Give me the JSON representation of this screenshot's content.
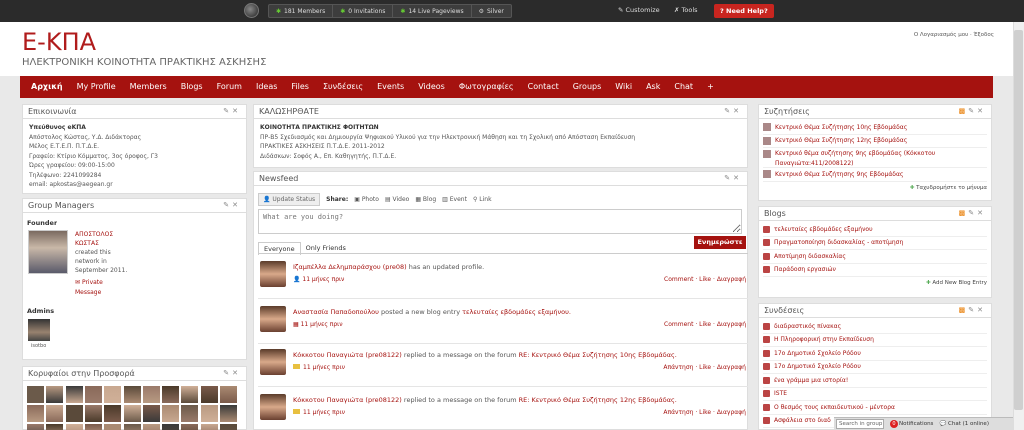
{
  "topbar": {
    "stats": [
      "181 Members",
      "0 Invitations",
      "14 Live Pageviews",
      "Silver"
    ],
    "customize": "Customize",
    "tools": "Tools",
    "help": "Need Help?"
  },
  "header": {
    "brand": "Ε-ΚΠΑ",
    "subtitle": "ΗΛΕΚΤΡΟΝΙΚΗ ΚΟΙΝΟΤΗΤΑ ΠΡΑΚΤΙΚΗΣ ΑΣΚΗΣΗΣ",
    "account": "Ο Λογαριασμός μου",
    "signout": "Έξοδος"
  },
  "nav": [
    "Αρχική",
    "My Profile",
    "Members",
    "Blogs",
    "Forum",
    "Ideas",
    "Files",
    "Συνδέσεις",
    "Events",
    "Videos",
    "Φωτογραφίες",
    "Contact",
    "Groups",
    "Wiki",
    "Ask",
    "Chat",
    "+"
  ],
  "contact": {
    "title": "Επικοινωνία",
    "lines": [
      "Υπεύθυνος eΚΠΑ",
      "Απόστολος Κώστας, Υ.Δ. Διδάκτορας",
      "Μέλος Ε.Τ.Ε.Π. Π.Τ.Δ.Ε.",
      "Γραφείο: Κτίριο Κόμματος, 3ος όροφος, Γ3",
      "Ώρες γραφείου: 09:00-15:00",
      "Τηλέφωνο: 2241099284",
      "email: apkostas@aegean.gr"
    ]
  },
  "managers": {
    "title": "Group Managers",
    "founder_label": "Founder",
    "founder_name1": "ΑΠΟΣΤΟΛΟΣ",
    "founder_name2": "ΚΩΣΤΑΣ",
    "founder_info": [
      "created this",
      "network in",
      "September 2011."
    ],
    "private_message": "Private Message",
    "admins_label": "Admins",
    "admin_name": "isotbo"
  },
  "top_contributors": {
    "title": "Κορυφαίοι στην Προσφορά"
  },
  "welcome": {
    "title": "ΚΑΛΩΣΗΡΘΑΤΕ",
    "lines": [
      "ΚΟΙΝΟΤΗΤΑ ΠΡΑΚΤΙΚΗΣ ΦΟΙΤΗΤΩΝ",
      "ΠΡ-Β5 Σχεδιασμός και Δημιουργία Ψηφιακού Υλικού για την Ηλεκτρονική Μάθηση και τη Σχολική από Απόσταση Εκπαίδευση",
      "ΠΡΑΚΤΙΚΕΣ ΑΣΚΗΣΕΙΣ Π.Τ.Δ.Ε. 2011-2012",
      "Διδάσκων: Σοφός Α., Επ. Καθηγητής, Π.Τ.Δ.Ε."
    ]
  },
  "newsfeed": {
    "title": "Newsfeed",
    "update_status": "Update Status",
    "share_label": "Share:",
    "share_items": [
      "Photo",
      "Video",
      "Blog",
      "Event",
      "Link"
    ],
    "placeholder": "What are you doing?",
    "post_button": "Ενημερώστε",
    "tab_everyone": "Everyone",
    "tab_friends": "Only Friends",
    "items": [
      {
        "name": "Ιζαμπέλλα Δελημπαράσχου (pre08)",
        "text": " has an updated profile.",
        "link": "",
        "time": "11 μήνες πριν",
        "actions": "Comment · Like · Διαγραφή"
      },
      {
        "name": "Αναστασία Παπαδοπούλου",
        "text": " posted a new blog entry ",
        "link": "τελευταίες εβδομάδες εξαμήνου.",
        "time": "11 μήνες πριν",
        "actions": "Comment · Like · Διαγραφή"
      },
      {
        "name": "Κόκκοτου Παναγιώτα (pre08122)",
        "text": " replied to a message on the forum ",
        "link": "RE: Κεντρικό Θέμα Συζήτησης 10ης Εβδομάδας.",
        "time": "11 μήνες πριν",
        "actions": "Απάντηση · Like · Διαγραφή"
      },
      {
        "name": "Κόκκοτου Παναγιώτα (pre08122)",
        "text": " replied to a message on the forum ",
        "link": "RE: Κεντρικό Θέμα Συζήτησης 12ης Εβδομάδας.",
        "time": "11 μήνες πριν",
        "actions": "Απάντηση · Like · Διαγραφή"
      }
    ]
  },
  "discussions": {
    "title": "Συζητήσεις",
    "items": [
      "Κεντρικό Θέμα Συζήτησης 10ης Εβδομάδας",
      "Κεντρικό Θέμα Συζήτησης 12ης Εβδομάδας",
      "Κεντρικό θέμα συζήτησης 9ης εβδομάδας (Κόκκοτου",
      "Παναγιώτα:411/2008122)",
      "Κεντρικό Θέμα Συζήτησης 9ης Εβδομάδας"
    ],
    "more": "Ταχυδρομήστε το μήνυμα"
  },
  "blogs": {
    "title": "Blogs",
    "items": [
      "τελευταίες εβδομάδες εξαμήνου",
      "Πραγματοποίηση διδασκαλίας - αποτίμηση",
      "Αποτίμηση διδασκαλίας",
      "Παράδοση εργασιών"
    ],
    "more": "Add New Blog Entry"
  },
  "links": {
    "title": "Συνδέσεις",
    "items": [
      "διαδραστικός πίνακας",
      "Η Πληροφορική στην Εκπαίδευση",
      "17ο Δημοτικό Σχολείο Ρόδου",
      "17ο Δημοτικό Σχολείο Ρόδου",
      "ένα γράμμα μια ιστορία!",
      "ISTE",
      "Ο θεσμός τους εκπαιδευτικού - μέντορα",
      "Ασφάλεια στο διαδ"
    ]
  },
  "bottom": {
    "search": "Search in group",
    "notif_count": "0",
    "notif": "Notifications",
    "chat": "Chat (1 online)"
  }
}
